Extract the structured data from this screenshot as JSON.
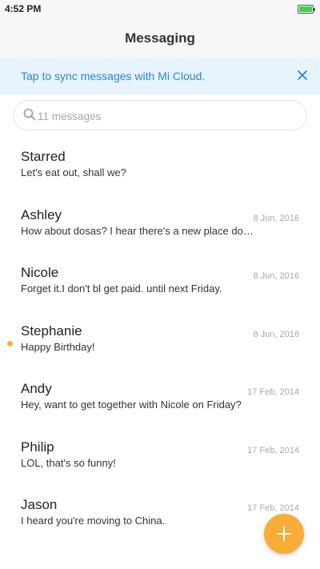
{
  "status_bar": {
    "time": "4:52 PM",
    "battery_icon": "battery-icon",
    "battery_color": "#3fd14a"
  },
  "header": {
    "title": "Messaging"
  },
  "sync_banner": {
    "text": "Tap to sync messages with Mi Cloud.",
    "close_icon": "close-icon",
    "color": "#2a86d8"
  },
  "search": {
    "placeholder": "11 messages",
    "icon": "search-icon"
  },
  "conversations": [
    {
      "name": "Starred",
      "date": "",
      "preview": "Let's eat out, shall we?",
      "unread": false
    },
    {
      "name": "Ashley",
      "date": "8 Jun, 2016",
      "preview": "How about dosas? I hear there's a new place do…",
      "unread": false
    },
    {
      "name": "Nicole",
      "date": "8 Jun, 2016",
      "preview": "Forget it.I don't bl get paid. until next Friday.",
      "unread": false
    },
    {
      "name": "Stephanie",
      "date": "8 Jun, 2016",
      "preview": "Happy Birthday!",
      "unread": true
    },
    {
      "name": "Andy",
      "date": "17 Feb, 2014",
      "preview": "Hey, want to get together with Nicole on Friday?",
      "unread": false
    },
    {
      "name": "Philip",
      "date": "17 Feb, 2014",
      "preview": "LOL, that's so funny!",
      "unread": false
    },
    {
      "name": "Jason",
      "date": "17 Feb, 2014",
      "preview": "I heard you're moving to China.",
      "unread": false
    }
  ],
  "fab": {
    "icon": "plus-icon",
    "color": "#f7ad37"
  },
  "accent_unread": "#f5b128"
}
